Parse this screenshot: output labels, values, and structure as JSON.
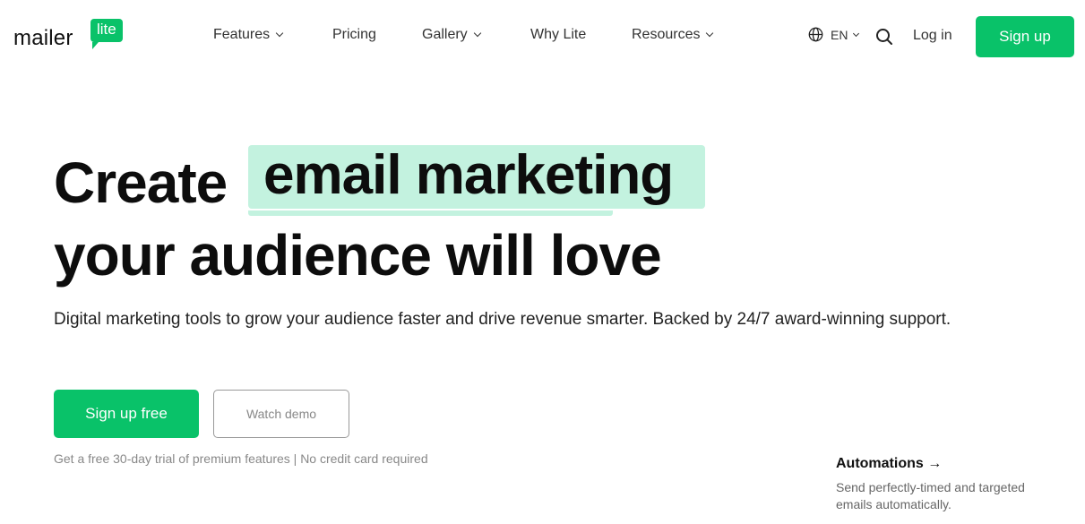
{
  "brand": {
    "logo_text": "mailer",
    "logo_badge": "lite",
    "accent_color": "#09c269",
    "highlight_color": "#c3f2df"
  },
  "nav": {
    "items": [
      {
        "label": "Features",
        "has_dropdown": true
      },
      {
        "label": "Pricing",
        "has_dropdown": false
      },
      {
        "label": "Gallery",
        "has_dropdown": true
      },
      {
        "label": "Why Lite",
        "has_dropdown": false
      },
      {
        "label": "Resources",
        "has_dropdown": true
      }
    ],
    "language": "EN",
    "login_label": "Log in",
    "signup_label": "Sign up"
  },
  "hero": {
    "title_part1": "Create",
    "title_highlight": "email marketing",
    "title_part2": "your audience will love",
    "subtitle": "Digital marketing tools to grow your audience faster and drive revenue smarter. Backed by 24/7 award-winning support.",
    "primary_cta": "Sign up free",
    "secondary_cta": "Watch demo",
    "trial_note": "Get a free 30-day trial of premium features | No credit card required"
  },
  "feature_card": {
    "title": "Automations →",
    "description": "Send perfectly-timed and targeted emails automatically."
  }
}
